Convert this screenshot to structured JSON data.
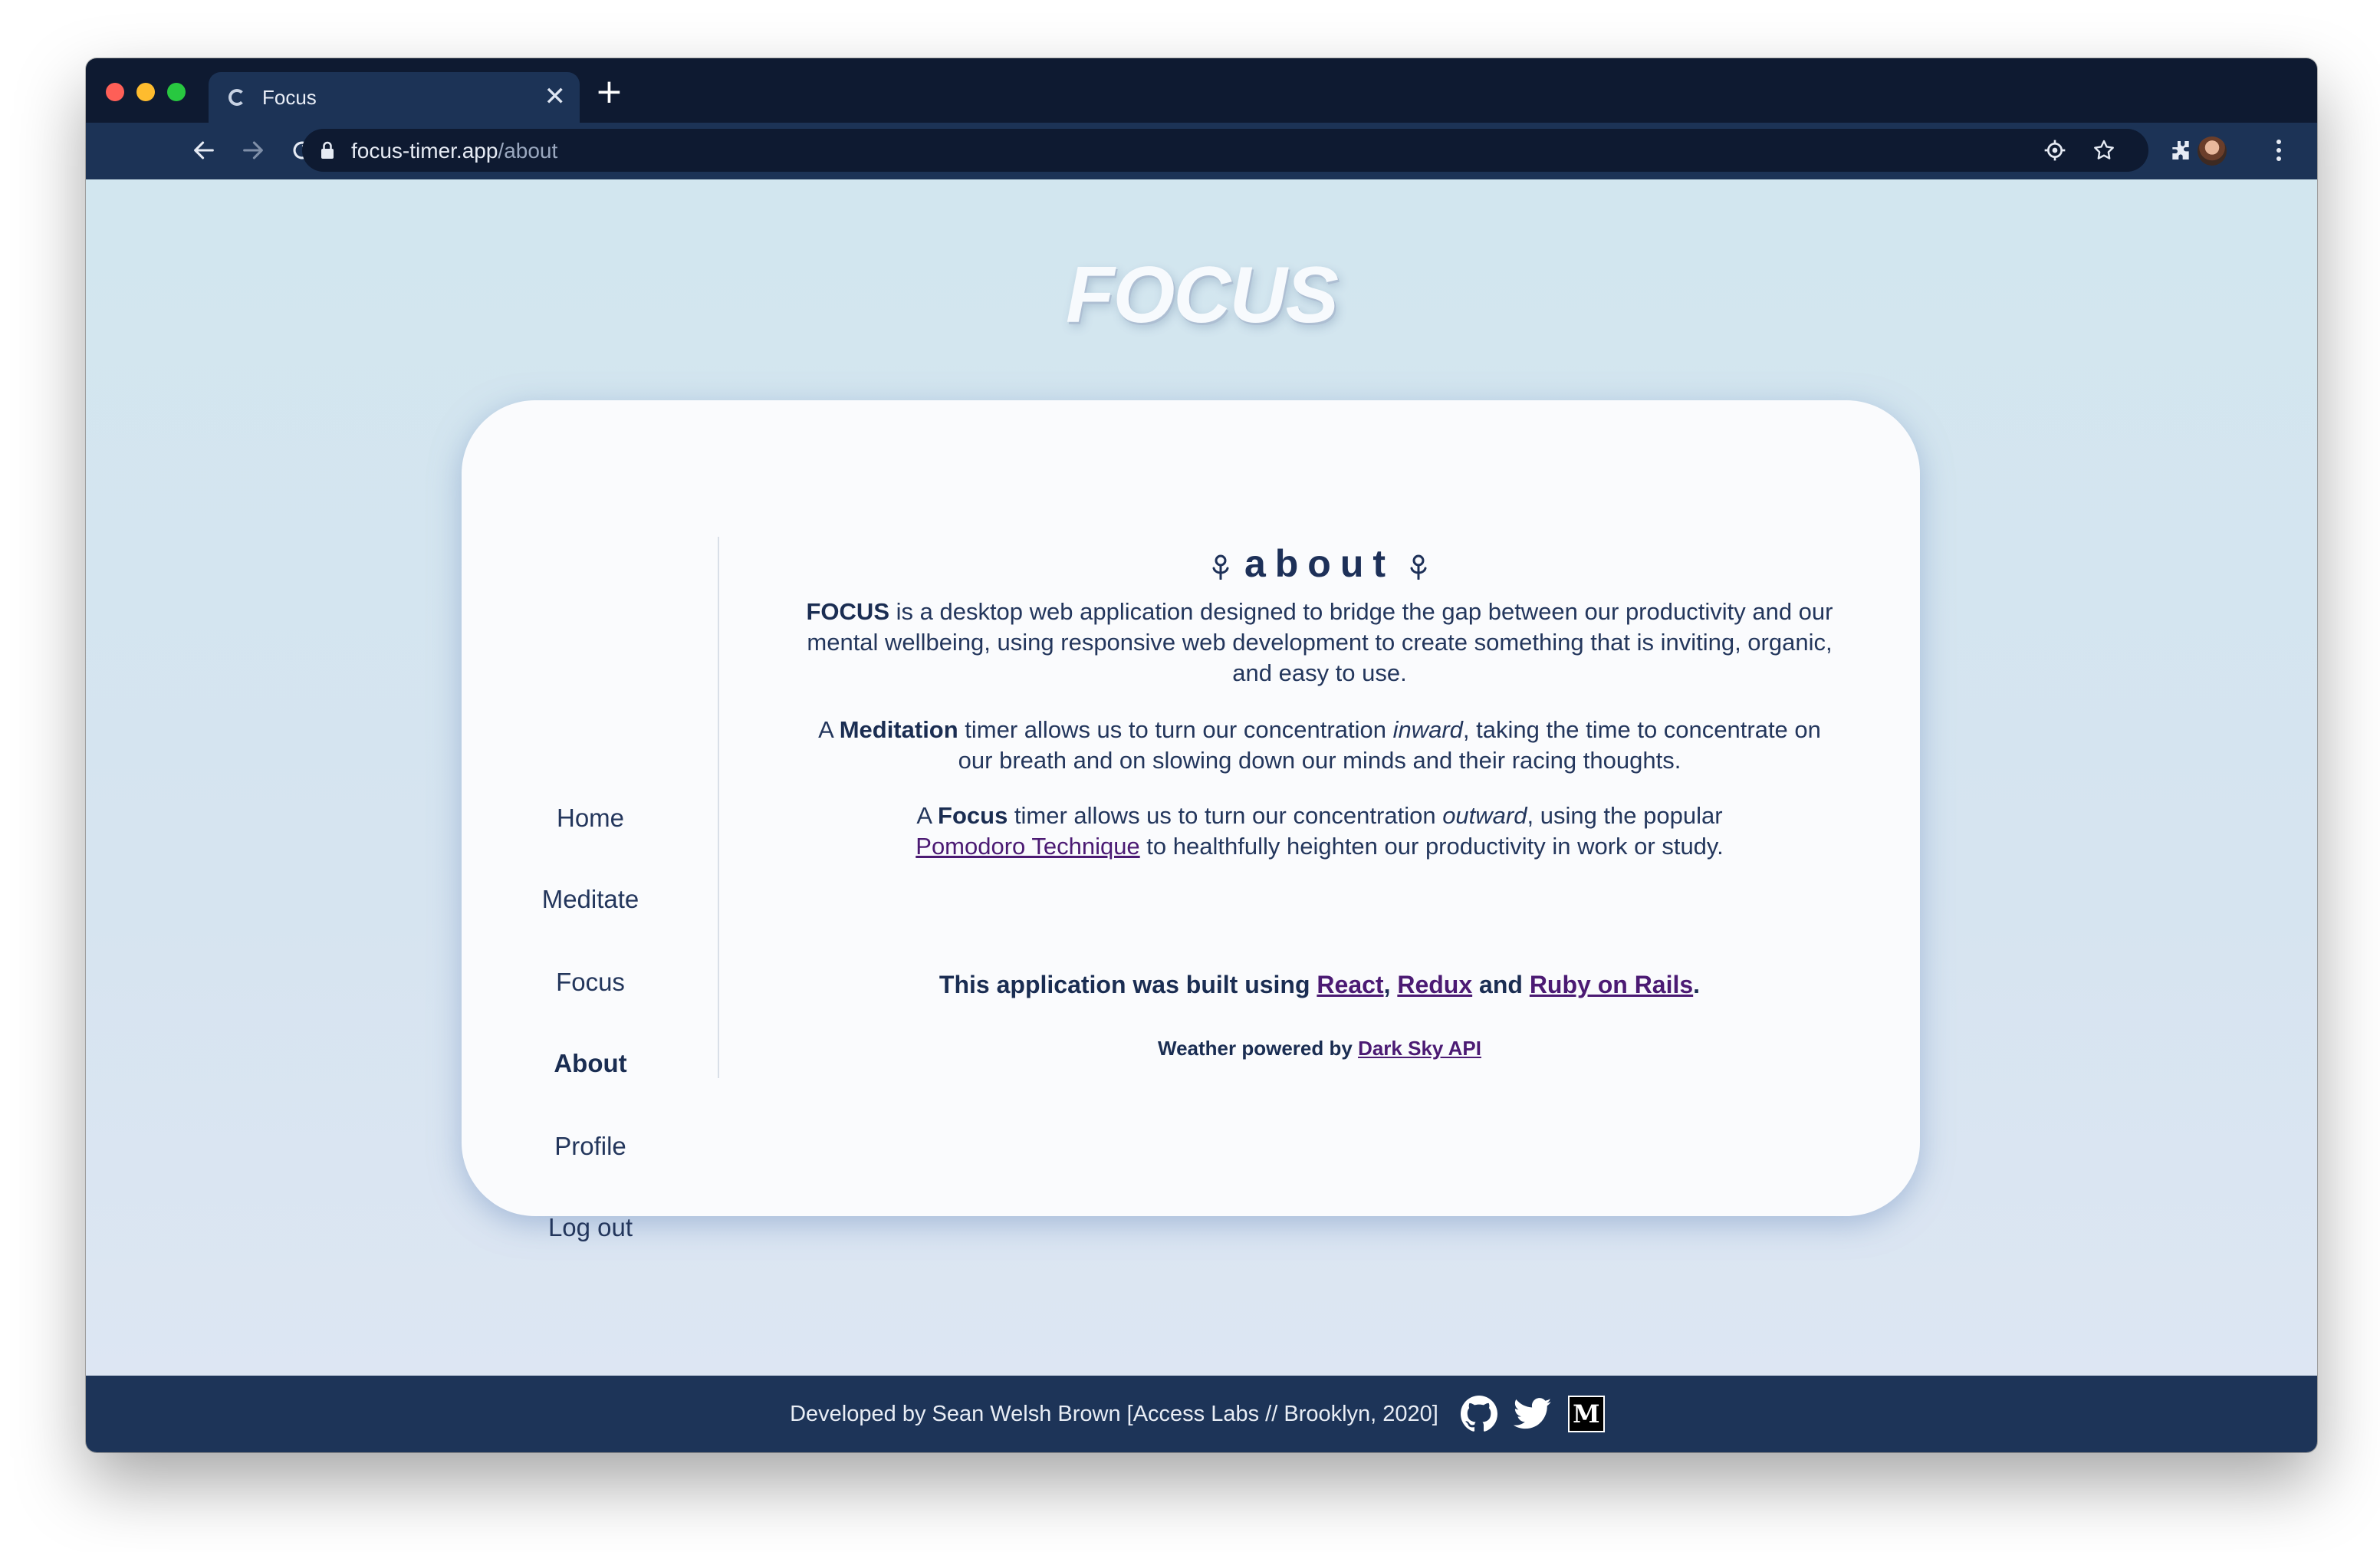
{
  "browser": {
    "tab_title": "Focus",
    "close_glyph": "✕",
    "new_tab_glyph": "+",
    "url_domain": "focus-timer.app",
    "url_path": "/about"
  },
  "brand": {
    "title": "FOCUS"
  },
  "nav": {
    "items": [
      {
        "label": "Home"
      },
      {
        "label": "Meditate"
      },
      {
        "label": "Focus"
      },
      {
        "label": "About",
        "active": true
      },
      {
        "label": "Profile"
      },
      {
        "label": "Log out"
      }
    ]
  },
  "about": {
    "heading": "about",
    "p1": {
      "bold": "FOCUS",
      "text": " is a desktop web application designed to bridge the gap between our productivity and our mental wellbeing, using responsive web development to create something that is inviting, organic, and easy to use."
    },
    "p2": {
      "pre": "A ",
      "bold": "Meditation",
      "mid": " timer allows us to turn our concentration ",
      "italic": "inward",
      "post": ", taking the time to concentrate on our breath and on slowing down our minds and their racing thoughts."
    },
    "p3": {
      "pre": "A ",
      "bold": "Focus",
      "mid": " timer allows us to turn our concentration ",
      "italic": "outward",
      "mid2": ", using the popular ",
      "link": "Pomodoro Technique",
      "post": " to healthfully heighten our productivity in work or study."
    },
    "built": {
      "pre": "This application was built using ",
      "link1": "React",
      "sep1": ", ",
      "link2": "Redux",
      "sep2": " and ",
      "link3": "Ruby on Rails",
      "end": "."
    },
    "weather": {
      "pre": "Weather powered by ",
      "link": "Dark Sky API"
    }
  },
  "footer": {
    "text": "Developed by Sean Welsh Brown [Access Labs // Brooklyn, 2020]",
    "icons": [
      "github-icon",
      "twitter-icon",
      "medium-icon"
    ],
    "medium_glyph": "M"
  },
  "colors": {
    "navy": "#1d3458",
    "text": "#23365c",
    "link": "#4b1a73",
    "page_bg": "#d4e6ee",
    "card_bg": "#fafbfd"
  }
}
